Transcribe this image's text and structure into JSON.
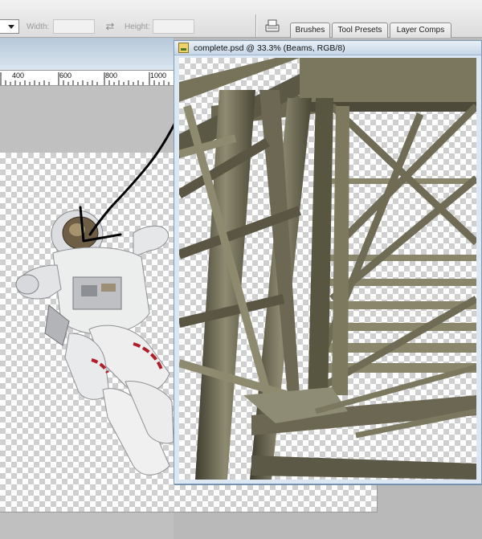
{
  "options_bar": {
    "width_label": "Width:",
    "height_label": "Height:",
    "swap_icon": "swap-arrows-icon"
  },
  "palette_tabs": [
    {
      "label": "Brushes"
    },
    {
      "label": "Tool Presets"
    },
    {
      "label": "Layer Comps"
    }
  ],
  "ruler": {
    "ticks": [
      "400",
      "600",
      "800",
      "1000"
    ]
  },
  "document": {
    "title": "complete.psd @ 33.3% (Beams, RGB/8)"
  },
  "colors": {
    "title_bar": "#c6d6e6",
    "arrow": "#000000",
    "beam": "#6e6a52"
  }
}
